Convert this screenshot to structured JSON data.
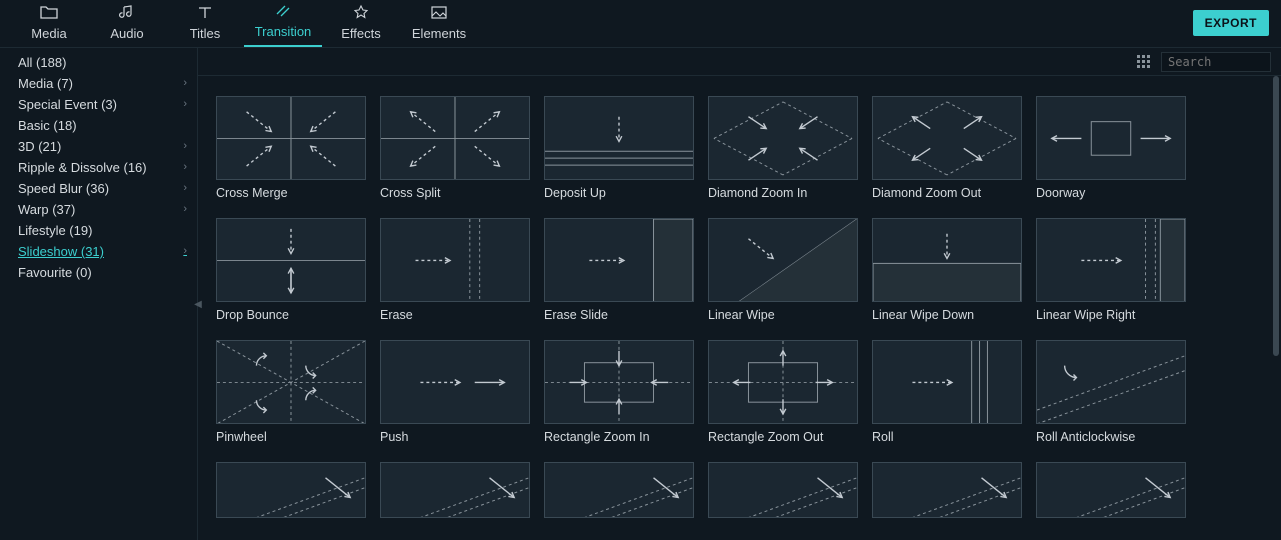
{
  "topTabs": [
    {
      "label": "Media"
    },
    {
      "label": "Audio"
    },
    {
      "label": "Titles"
    },
    {
      "label": "Transition"
    },
    {
      "label": "Effects"
    },
    {
      "label": "Elements"
    }
  ],
  "activeTopTab": 3,
  "exportLabel": "EXPORT",
  "sidebar": [
    {
      "label": "All (188)",
      "chevron": false
    },
    {
      "label": "Media (7)",
      "chevron": true
    },
    {
      "label": "Special Event (3)",
      "chevron": true
    },
    {
      "label": "Basic (18)",
      "chevron": false
    },
    {
      "label": "3D (21)",
      "chevron": true
    },
    {
      "label": "Ripple & Dissolve (16)",
      "chevron": true
    },
    {
      "label": "Speed Blur (36)",
      "chevron": true
    },
    {
      "label": "Warp (37)",
      "chevron": true
    },
    {
      "label": "Lifestyle (19)",
      "chevron": false
    },
    {
      "label": "Slideshow (31)",
      "chevron": true,
      "active": true
    },
    {
      "label": "Favourite (0)",
      "chevron": false
    }
  ],
  "searchPlaceholder": "Search",
  "transitions": [
    "Cross Merge",
    "Cross Split",
    "Deposit Up",
    "Diamond Zoom In",
    "Diamond Zoom Out",
    "Doorway",
    "Drop Bounce",
    "Erase",
    "Erase Slide",
    "Linear Wipe",
    "Linear Wipe Down",
    "Linear Wipe Right",
    "Pinwheel",
    "Push",
    "Rectangle Zoom In",
    "Rectangle Zoom Out",
    "Roll",
    "Roll Anticlockwise",
    "",
    "",
    "",
    "",
    "",
    ""
  ]
}
